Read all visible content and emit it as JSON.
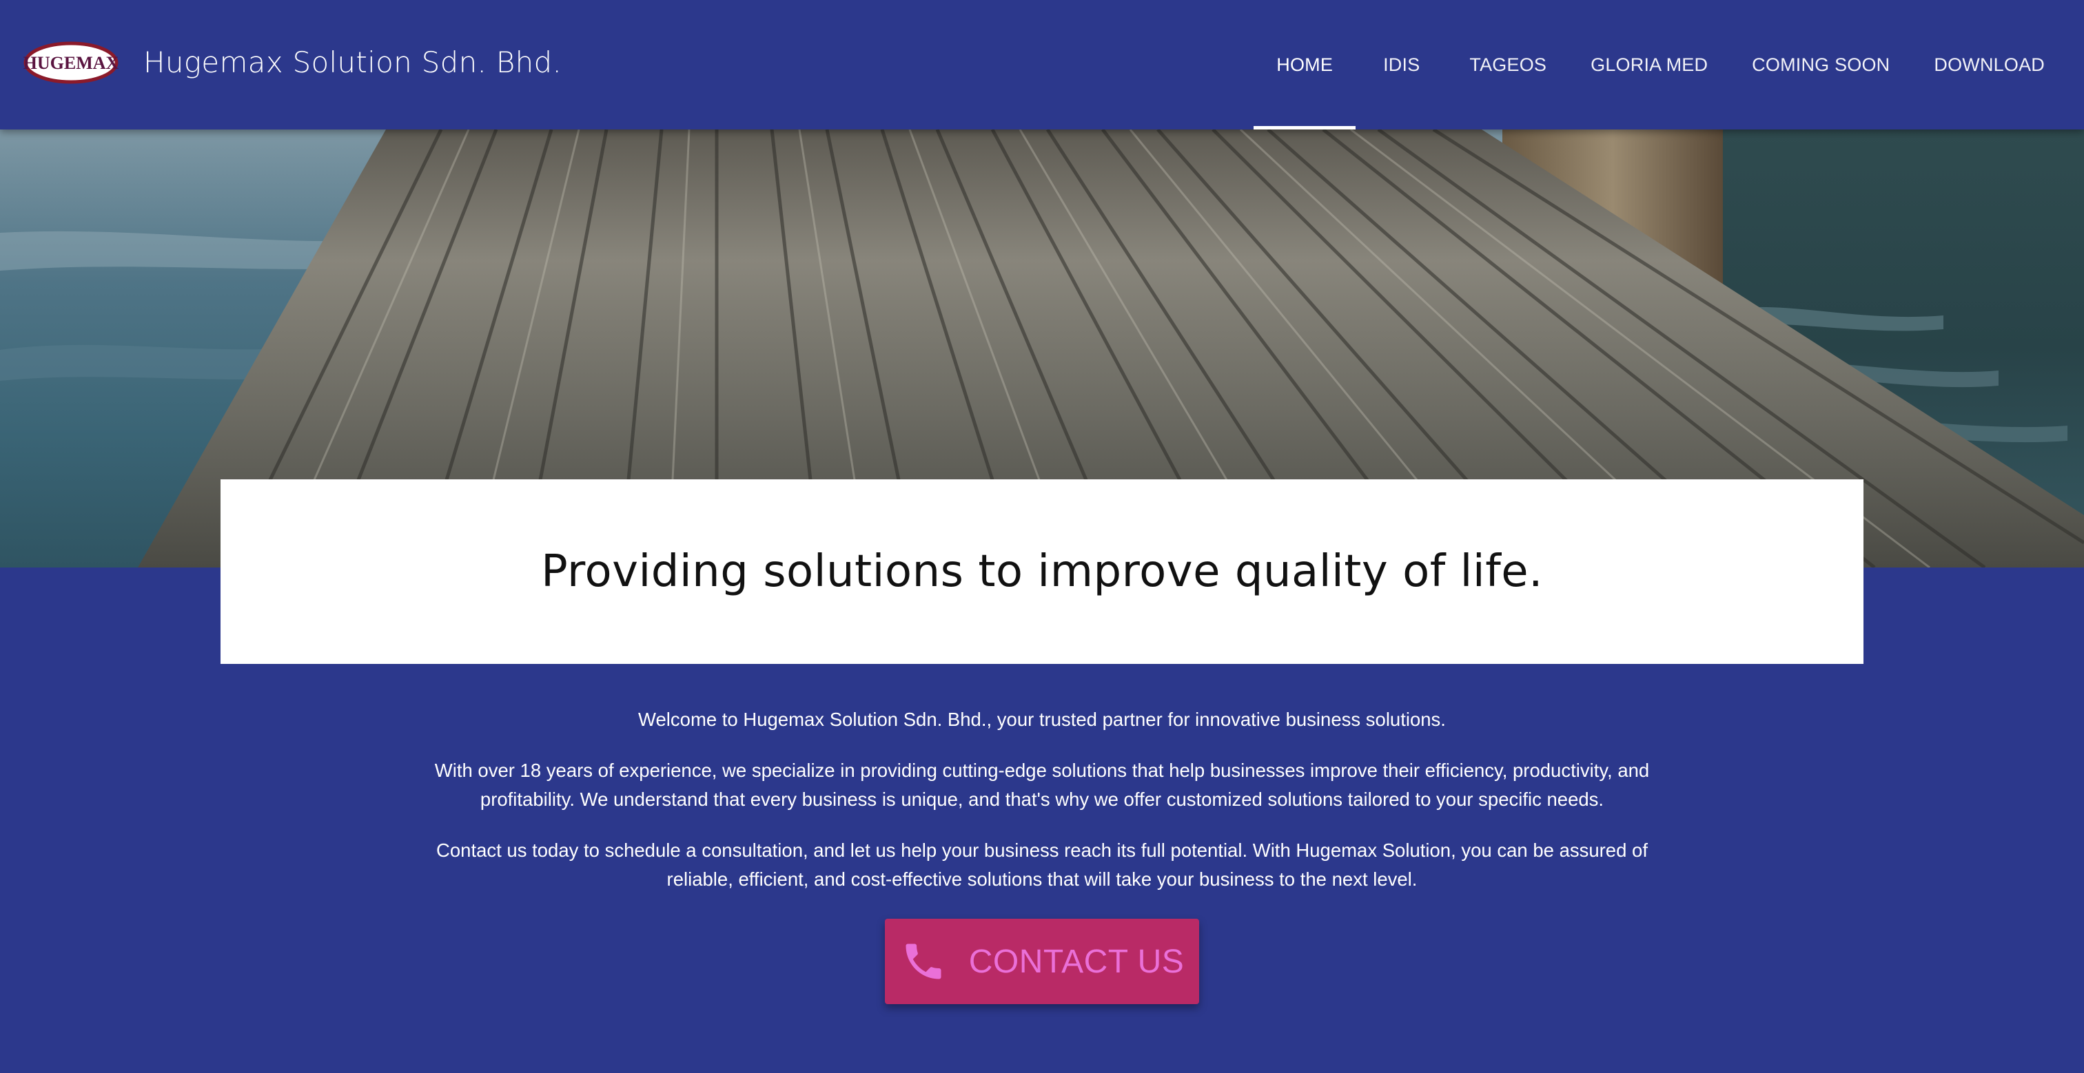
{
  "header": {
    "logo_text": "HUGEMAX",
    "brand_name": "Hugemax Solution Sdn. Bhd.",
    "nav": [
      {
        "label": "HOME",
        "active": true
      },
      {
        "label": "IDIS",
        "active": false
      },
      {
        "label": "TAGEOS",
        "active": false
      },
      {
        "label": "GLORIA MED",
        "active": false
      },
      {
        "label": "COMING SOON",
        "active": false
      },
      {
        "label": "DOWNLOAD",
        "active": false
      }
    ]
  },
  "hero": {
    "tagline": "Providing solutions to improve quality of life."
  },
  "content": {
    "paragraphs": [
      "Welcome to Hugemax Solution Sdn. Bhd., your trusted partner for innovative business solutions.",
      "With over 18 years of experience, we specialize in providing cutting-edge solutions that help businesses improve their efficiency, productivity, and profitability. We understand that every business is unique, and that's why we offer customized solutions tailored to your specific needs.",
      "Contact us today to schedule a consultation, and let us help your business reach its full potential. With Hugemax Solution, you can be assured of reliable, efficient, and cost-effective solutions that will take your business to the next level."
    ],
    "contact_button": {
      "label": "CONTACT US",
      "icon": "phone-icon"
    }
  },
  "colors": {
    "primary": "#2c388c",
    "accent_button": "#b92a66",
    "accent_text": "#ea70d8",
    "logo_red": "#8b1a2a"
  }
}
